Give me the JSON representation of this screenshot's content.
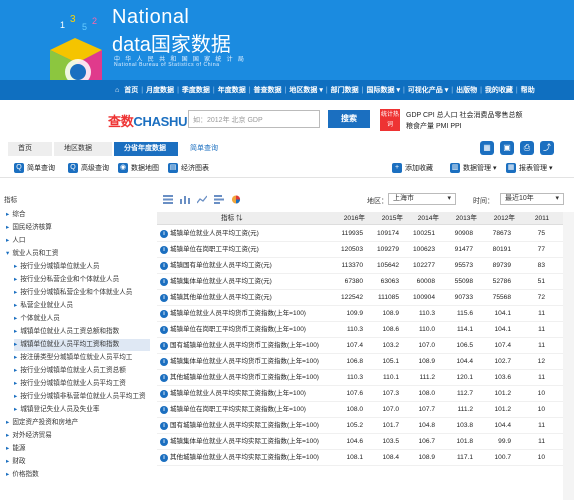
{
  "header": {
    "brand_line1": "National",
    "brand_line2": "data国家数据",
    "brand_sub1": "中 华 人 民 共 和 国 国 家 统 计 局",
    "brand_sub2": "National Bureau of Statistics of China"
  },
  "menu": [
    "首页",
    "月度数据",
    "季度数据",
    "年度数据",
    "普查数据",
    "地区数据 ▾",
    "部门数据",
    "国际数据 ▾",
    "可视化产品 ▾",
    "出版物",
    "我的收藏",
    "帮助"
  ],
  "search": {
    "logo_en": "CHASHU",
    "logo_cn": "查数",
    "placeholder": "如：2012年 北京 GDP",
    "button": "搜索",
    "hot_label": "统计热词",
    "hot_links_line1": "GDP  CPI  总人口  社会消费品零售总额",
    "hot_links_line2": "粮食产量  PMI  PPI"
  },
  "breadcrumb": {
    "home": "首页",
    "region": "地区数据",
    "current": "分省年度数据",
    "quick": "简单查询"
  },
  "toolbar": {
    "simple": "简单查询",
    "advanced": "高级查询",
    "map": "数据地图",
    "chart": "经济图表",
    "favorite": "添加收藏",
    "manage": "数据管理 ▾",
    "report": "报表管理 ▾"
  },
  "sidebar": {
    "title": "指标",
    "items": [
      {
        "label": "综合",
        "level": 0
      },
      {
        "label": "国民经济核算",
        "level": 0
      },
      {
        "label": "人口",
        "level": 0
      },
      {
        "label": "就业人员和工资",
        "level": 0,
        "open": true
      },
      {
        "label": "按行业分城镇单位就业人员",
        "level": 1
      },
      {
        "label": "按行业分私营企业和个体就业人员",
        "level": 1
      },
      {
        "label": "按行业分城镇私营企业和个体就业人员",
        "level": 1
      },
      {
        "label": "私营企业就业人员",
        "level": 1
      },
      {
        "label": "个体就业人员",
        "level": 1
      },
      {
        "label": "城镇单位就业人员工资总额和指数",
        "level": 1
      },
      {
        "label": "城镇单位就业人员平均工资和指数",
        "level": 1,
        "selected": true
      },
      {
        "label": "按注册类型分城镇单位就业人员平均工",
        "level": 1
      },
      {
        "label": "按行业分城镇单位就业人员工资总额",
        "level": 1
      },
      {
        "label": "按行业分城镇单位就业人员平均工资",
        "level": 1
      },
      {
        "label": "按行业分城镇非私营单位就业人员平均工资",
        "level": 1
      },
      {
        "label": "城镇登记失业人员及失业率",
        "level": 1
      },
      {
        "label": "固定资产投资和房地产",
        "level": 0
      },
      {
        "label": "对外经济贸易",
        "level": 0
      },
      {
        "label": "能源",
        "level": 0
      },
      {
        "label": "财政",
        "level": 0
      },
      {
        "label": "价格指数",
        "level": 0
      }
    ]
  },
  "filters": {
    "region_label": "地区：",
    "region_value": "上海市",
    "time_label": "时间：",
    "time_value": "最近10年"
  },
  "table": {
    "headers": [
      "指标",
      "2016年",
      "2015年",
      "2014年",
      "2013年",
      "2012年",
      "2011"
    ],
    "rows": [
      {
        "name": "城镇单位就业人员平均工资(元)",
        "values": [
          "119935",
          "109174",
          "100251",
          "90908",
          "78673",
          "75"
        ]
      },
      {
        "name": "城镇单位在岗职工平均工资(元)",
        "values": [
          "120503",
          "109279",
          "100623",
          "91477",
          "80191",
          "77"
        ]
      },
      {
        "name": "城镇国有单位就业人员平均工资(元)",
        "values": [
          "113370",
          "105642",
          "102277",
          "95573",
          "89739",
          "83"
        ]
      },
      {
        "name": "城镇集体单位就业人员平均工资(元)",
        "values": [
          "67380",
          "63063",
          "60008",
          "55098",
          "52786",
          "51"
        ]
      },
      {
        "name": "城镇其他单位就业人员平均工资(元)",
        "values": [
          "122542",
          "111085",
          "100904",
          "90733",
          "75568",
          "72"
        ]
      },
      {
        "name": "城镇单位就业人员平均货币工资指数(上年=100)",
        "values": [
          "109.9",
          "108.9",
          "110.3",
          "115.6",
          "104.1",
          "11"
        ]
      },
      {
        "name": "城镇单位在岗职工平均货币工资指数(上年=100)",
        "values": [
          "110.3",
          "108.6",
          "110.0",
          "114.1",
          "104.1",
          "11"
        ]
      },
      {
        "name": "国有城镇单位就业人员平均货币工资指数(上年=100)",
        "values": [
          "107.4",
          "103.2",
          "107.0",
          "106.5",
          "107.4",
          "11"
        ]
      },
      {
        "name": "城镇集体单位就业人员平均货币工资指数(上年=100)",
        "values": [
          "106.8",
          "105.1",
          "108.9",
          "104.4",
          "102.7",
          "12"
        ]
      },
      {
        "name": "其他城镇单位就业人员平均货币工资指数(上年=100)",
        "values": [
          "110.3",
          "110.1",
          "111.2",
          "120.1",
          "103.6",
          "11"
        ]
      },
      {
        "name": "城镇单位就业人员平均实际工资指数(上年=100)",
        "values": [
          "107.6",
          "107.3",
          "108.0",
          "112.7",
          "101.2",
          "10"
        ]
      },
      {
        "name": "城镇单位在岗职工平均实际工资指数(上年=100)",
        "values": [
          "108.0",
          "107.0",
          "107.7",
          "111.2",
          "101.2",
          "10"
        ]
      },
      {
        "name": "国有城镇单位就业人员平均实际工资指数(上年=100)",
        "values": [
          "105.2",
          "101.7",
          "104.8",
          "103.8",
          "104.4",
          "11"
        ]
      },
      {
        "name": "城镇集体单位就业人员平均实际工资指数(上年=100)",
        "values": [
          "104.6",
          "103.5",
          "106.7",
          "101.8",
          "99.9",
          "11"
        ]
      },
      {
        "name": "其他城镇单位就业人员平均实际工资指数(上年=100)",
        "values": [
          "108.1",
          "108.4",
          "108.9",
          "117.1",
          "100.7",
          "10"
        ]
      }
    ]
  }
}
